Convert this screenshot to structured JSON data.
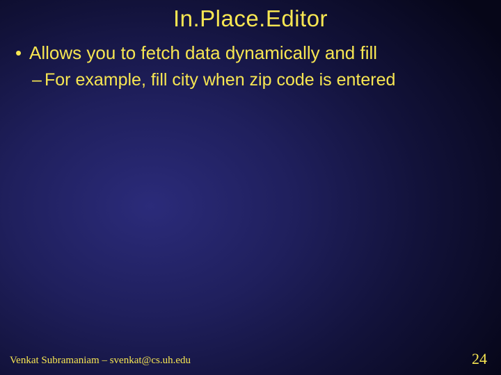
{
  "title": "In.Place.Editor",
  "bullets": {
    "l1": "Allows you to fetch data dynamically and fill",
    "l2": "For example, fill city when zip code is entered"
  },
  "footer": {
    "author": "Venkat Subramaniam – svenkat@cs.uh.edu",
    "page": "24"
  }
}
